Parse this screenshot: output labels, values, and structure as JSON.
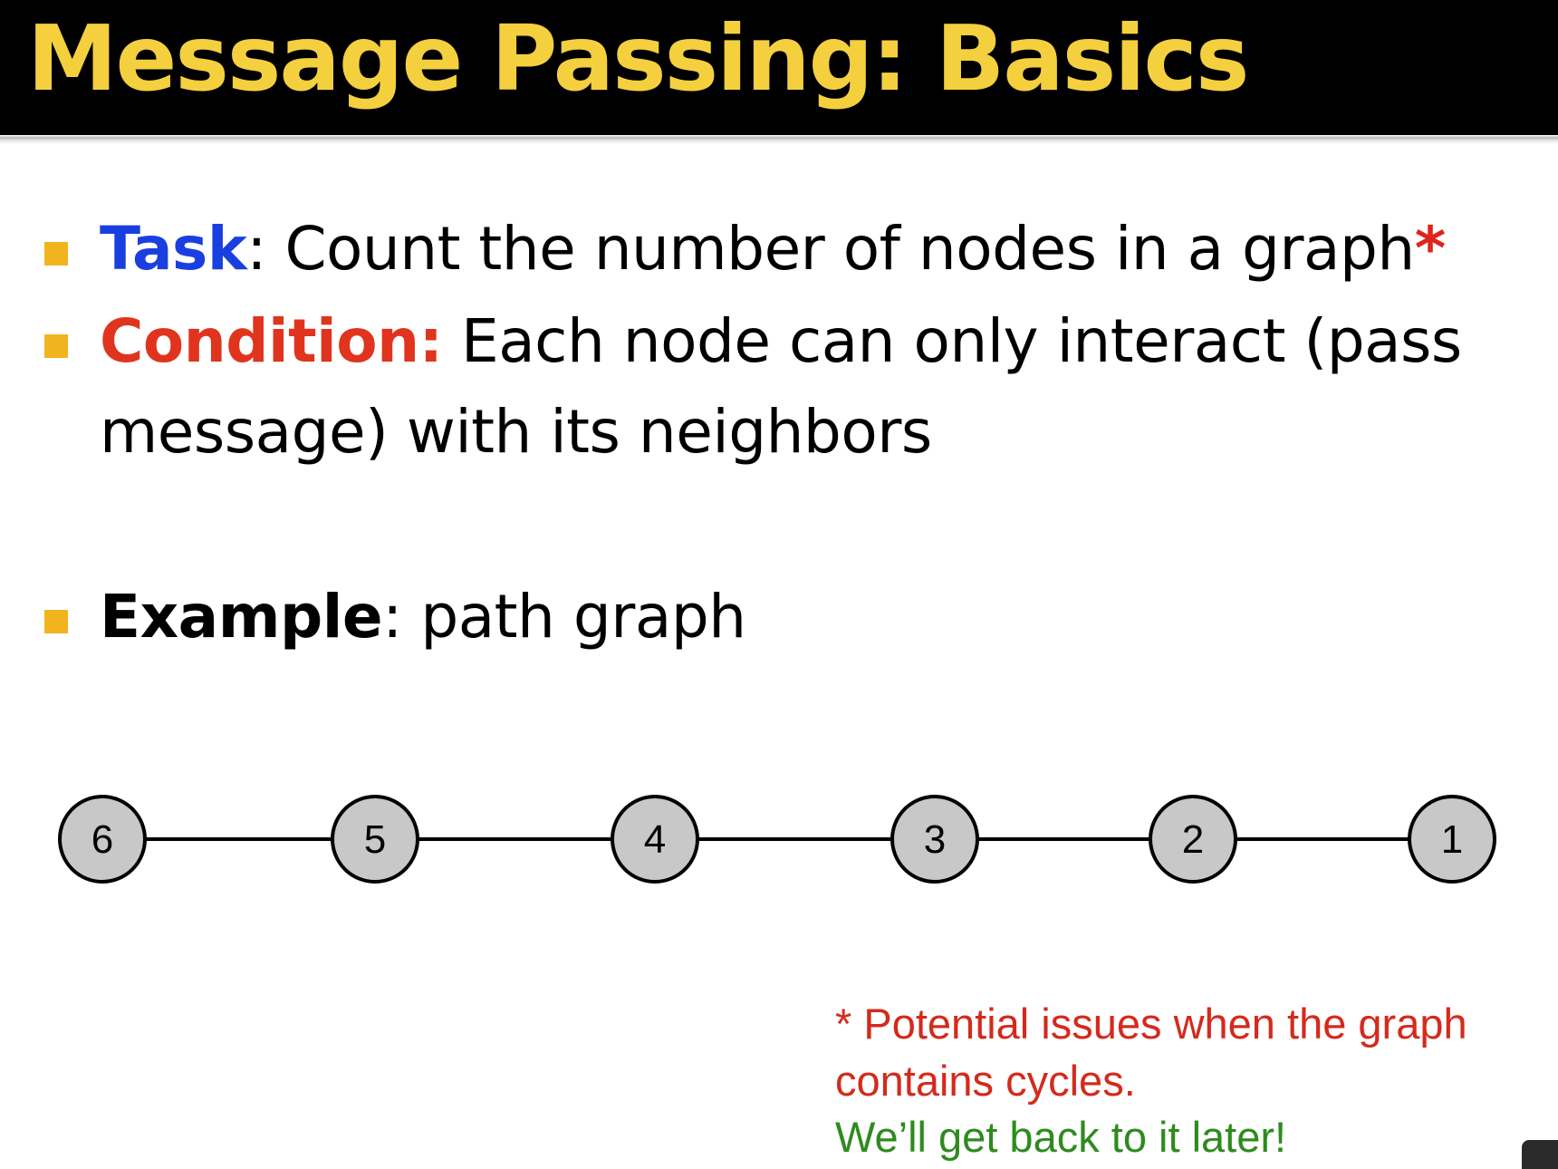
{
  "title": {
    "text": "Message Passing: Basics",
    "color": "#f4d03f"
  },
  "bullets": [
    {
      "keyword": "Task",
      "keyword_color": "#1a3fe0",
      "text": ": Count the number of nodes in a graph",
      "suffix": "*",
      "suffix_color": "#e0241b"
    },
    {
      "keyword": "Condition:",
      "keyword_color": "#e0341e",
      "text_line1": " Each node can only interact (pass",
      "text_line2": "message) with its neighbors"
    },
    {
      "keyword": "Example",
      "keyword_color": "#000000",
      "text": ": path graph"
    }
  ],
  "graph": {
    "type": "path",
    "nodes": [
      "6",
      "5",
      "4",
      "3",
      "2",
      "1"
    ],
    "node_fill": "#c8c8c8",
    "node_stroke": "#000000"
  },
  "footnote": {
    "line1": "* Potential issues when the graph",
    "line2": "contains cycles.",
    "line1_color": "#d42a1c",
    "line3": "We’ll get back to it later!",
    "line3_color": "#2e8b1e"
  }
}
